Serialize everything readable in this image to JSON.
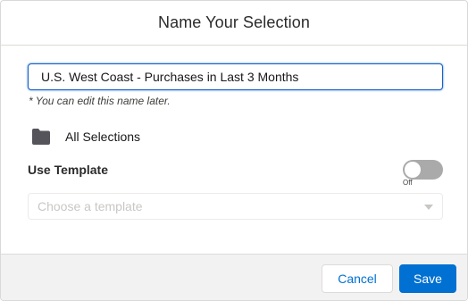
{
  "modal": {
    "title": "Name Your Selection"
  },
  "name_field": {
    "value": "U.S. West Coast - Purchases in Last 3 Months",
    "hint": "* You can edit this name later."
  },
  "folder": {
    "icon": "folder-icon",
    "label": "All Selections"
  },
  "template": {
    "label": "Use Template",
    "toggle_state": "Off",
    "toggle_on": false,
    "placeholder": "Choose a template"
  },
  "footer": {
    "cancel_label": "Cancel",
    "save_label": "Save"
  },
  "colors": {
    "accent": "#0070d2",
    "toggle_off": "#aaaaaa",
    "footer_bg": "#f3f2f2"
  }
}
